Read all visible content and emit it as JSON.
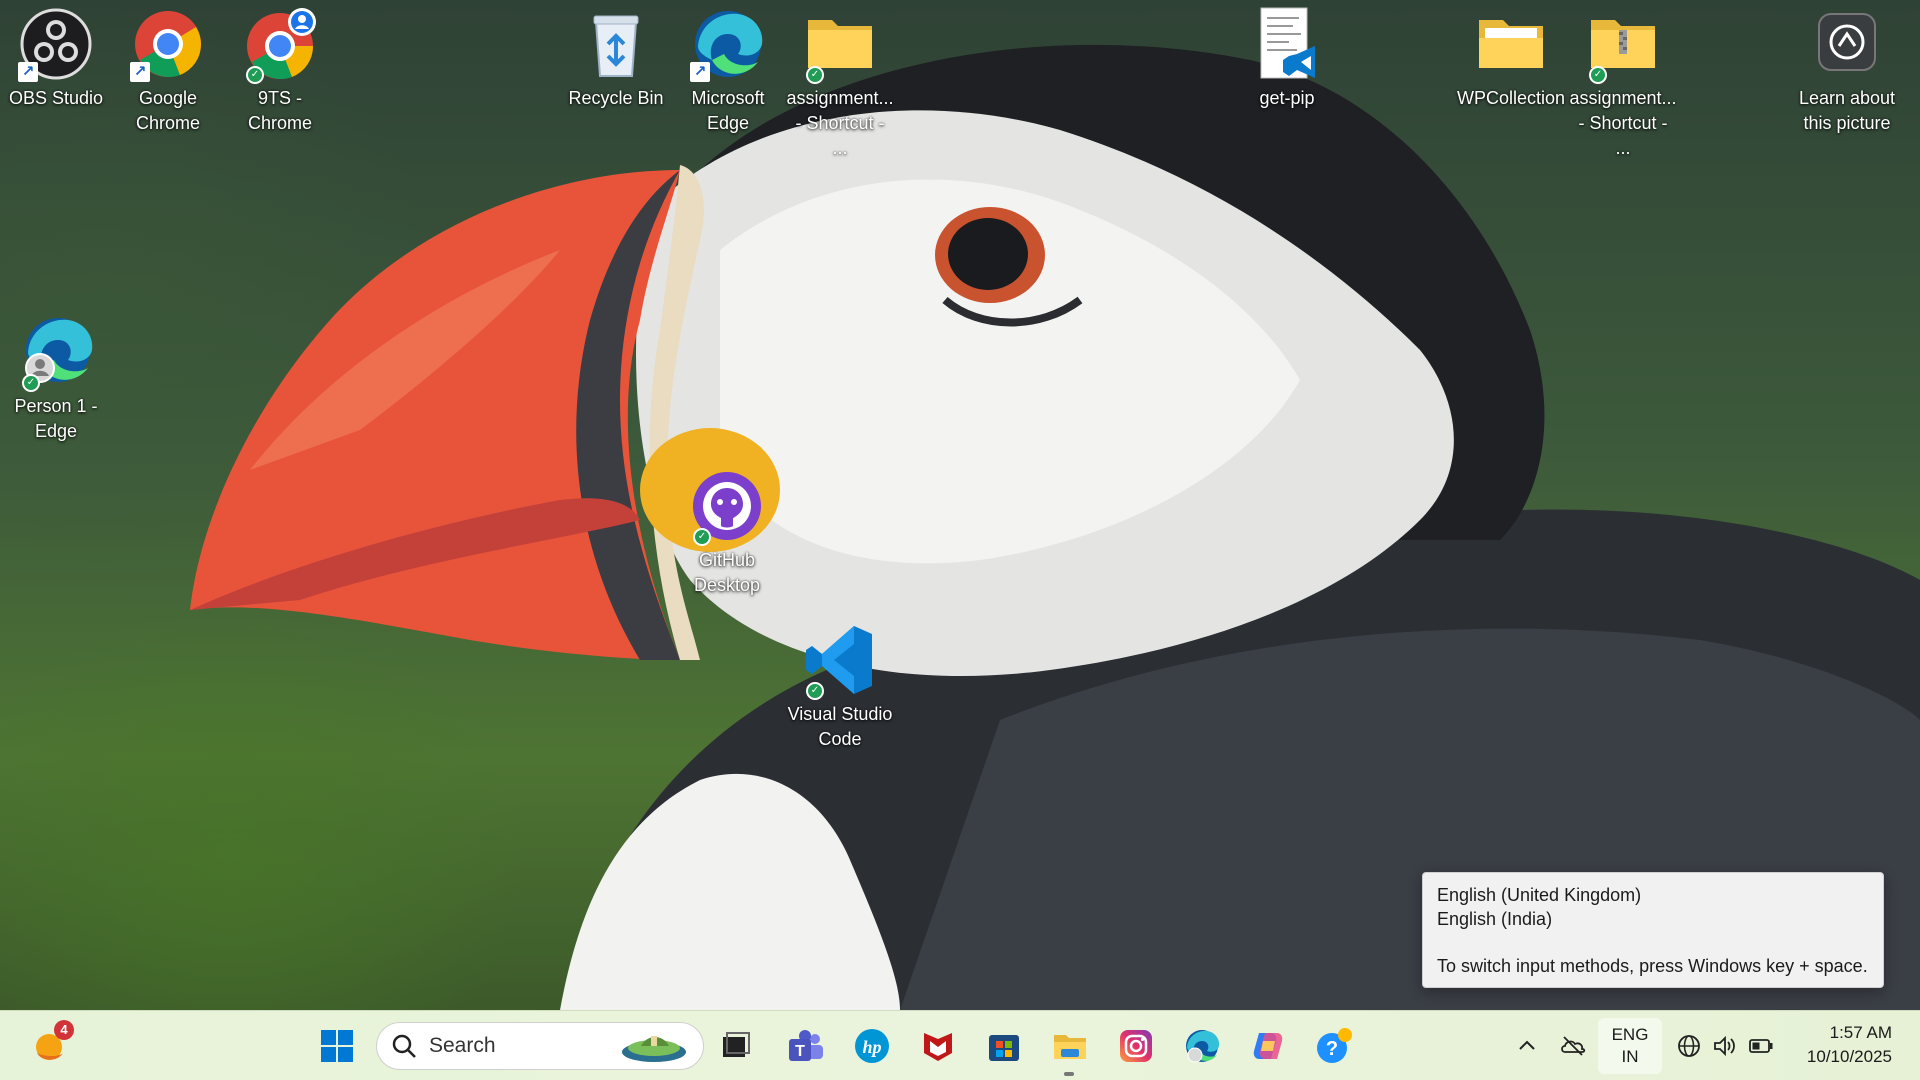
{
  "desktop": {
    "icons": [
      {
        "label": "OBS Studio",
        "icon": "obs-icon"
      },
      {
        "label": "Google\nChrome",
        "icon": "chrome-icon"
      },
      {
        "label": "9TS -\nChrome",
        "icon": "chrome-profile-icon"
      },
      {
        "label": "Recycle Bin",
        "icon": "recycle-bin-icon"
      },
      {
        "label": "Microsoft\nEdge",
        "icon": "edge-icon"
      },
      {
        "label": "assignment...\n- Shortcut - ...",
        "icon": "folder-icon"
      },
      {
        "label": "get-pip",
        "icon": "python-file-icon"
      },
      {
        "label": "WPCollection",
        "icon": "folder-icon"
      },
      {
        "label": "assignment...\n- Shortcut - ...",
        "icon": "zip-folder-icon"
      },
      {
        "label": "Learn about\nthis picture",
        "icon": "camera-icon"
      },
      {
        "label": "Person 1 -\nEdge",
        "icon": "edge-profile-icon"
      },
      {
        "label": "GitHub\nDesktop",
        "icon": "github-desktop-icon"
      },
      {
        "label": "Visual Studio\nCode",
        "icon": "vscode-icon"
      }
    ]
  },
  "language_flyout": {
    "line1": "English (United Kingdom)",
    "line2": "English (India)",
    "hint": "To switch input methods, press Windows key + space."
  },
  "taskbar": {
    "widgets_badge": "4",
    "search_placeholder": "Search",
    "apps": [
      "task-view-icon",
      "teams-icon",
      "hp-icon",
      "mcafee-icon",
      "microsoft-store-icon",
      "file-explorer-icon",
      "instagram-icon",
      "edge-icon",
      "copilot-icon",
      "get-help-icon"
    ],
    "tray": {
      "lang_line1": "ENG",
      "lang_line2": "IN",
      "time": "1:57 AM",
      "date": "10/10/2025"
    }
  },
  "colors": {
    "taskbar_bg": "#e7f3d8",
    "flyout_bg": "#f1f1f1",
    "windows_blue": "#0078d4"
  }
}
